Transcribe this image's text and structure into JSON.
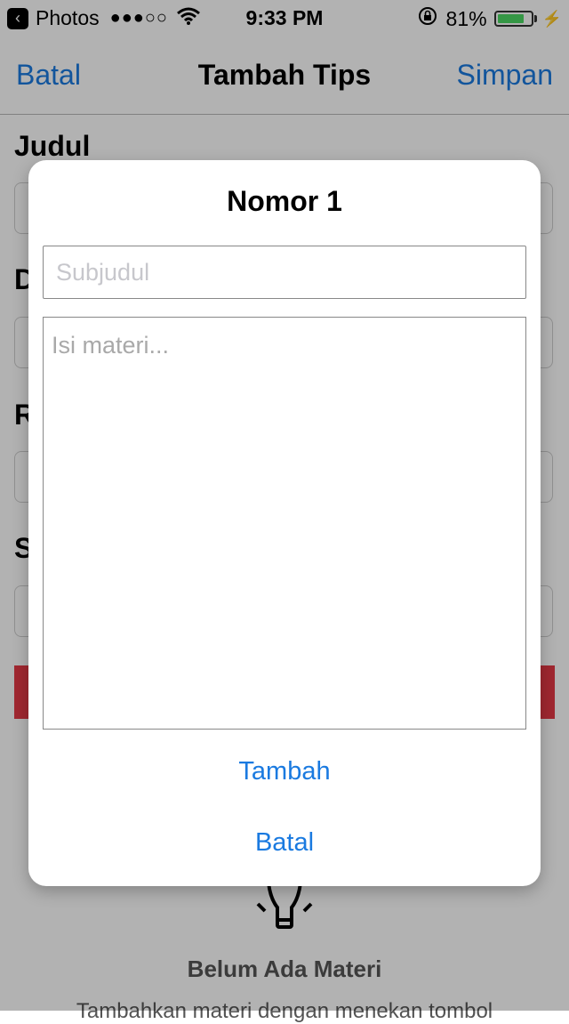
{
  "status_bar": {
    "back_app": "Photos",
    "signal": "●●●○○",
    "time": "9:33 PM",
    "battery_percent": "81%",
    "battery_level": 0.81
  },
  "navbar": {
    "left": "Batal",
    "title": "Tambah Tips",
    "right": "Simpan"
  },
  "form": {
    "labels": [
      "Judul",
      "D",
      "R",
      "S"
    ]
  },
  "empty_state": {
    "title": "Belum Ada Materi",
    "subtitle": "Tambahkan materi dengan menekan tombol"
  },
  "modal": {
    "title": "Nomor 1",
    "subtitle_placeholder": "Subjudul",
    "subtitle_value": "",
    "content_placeholder": "Isi materi...",
    "content_value": "",
    "add_label": "Tambah",
    "cancel_label": "Batal"
  },
  "colors": {
    "accent": "#1a7ae0",
    "danger": "#e63846",
    "battery": "#4cd964"
  }
}
